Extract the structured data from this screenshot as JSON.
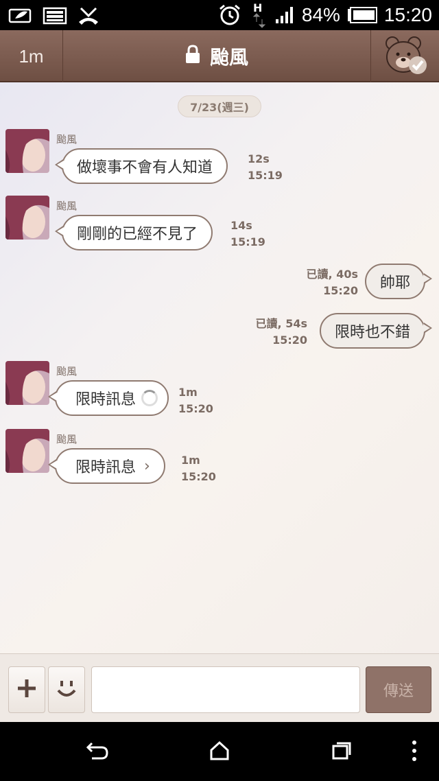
{
  "status_bar": {
    "battery": "84%",
    "time": "15:20",
    "network_type": "H",
    "icons": [
      "leaf-notification-icon",
      "image-notification-icon",
      "missed-call-icon",
      "alarm-icon",
      "network-arrows-icon",
      "signal-icon",
      "battery-icon"
    ]
  },
  "header": {
    "left_label": "1m",
    "title": "颱風",
    "lock_icon": "lock-icon",
    "sticker_icon": "bear-check-icon",
    "colors": {
      "background": "#7a5a4e"
    }
  },
  "chat": {
    "date": "7/23(週三)",
    "messages": [
      {
        "side": "in",
        "sender": "颱風",
        "text": "做壞事不會有人知道",
        "ttl": "12s",
        "time": "15:19"
      },
      {
        "side": "in",
        "sender": "颱風",
        "text": "剛剛的已經不見了",
        "ttl": "14s",
        "time": "15:19"
      },
      {
        "side": "out",
        "text": "帥耶",
        "read": "已讀, 40s",
        "time": "15:20"
      },
      {
        "side": "out",
        "text": "限時也不錯",
        "read": "已讀, 54s",
        "time": "15:20"
      },
      {
        "side": "in",
        "sender": "颱風",
        "text": "限時訊息",
        "ttl": "1m",
        "time": "15:20",
        "icon": "loading-spinner-icon"
      },
      {
        "side": "in",
        "sender": "颱風",
        "text": "限時訊息",
        "ttl": "1m",
        "time": "15:20",
        "icon": "chevron-right-icon",
        "chevron": "›"
      }
    ]
  },
  "input_bar": {
    "add_icon": "plus-icon",
    "emoji_icon": "smiley-icon",
    "value": "",
    "send_label": "傳送"
  },
  "nav_bar": {
    "icons": [
      "back-icon",
      "home-icon",
      "recent-apps-icon",
      "menu-icon"
    ]
  }
}
